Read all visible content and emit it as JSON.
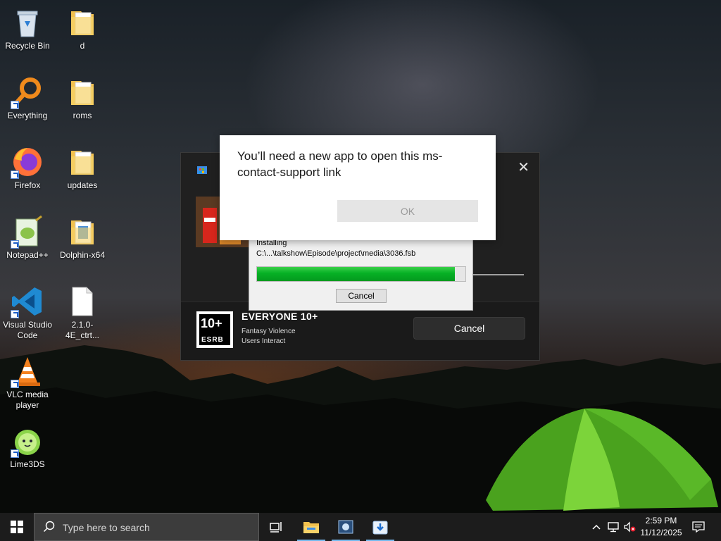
{
  "desktop": {
    "icons": [
      {
        "label": "Recycle Bin"
      },
      {
        "label": "d"
      },
      {
        "label": "Everything"
      },
      {
        "label": "roms"
      },
      {
        "label": "Firefox"
      },
      {
        "label": "updates"
      },
      {
        "label": "Notepad++"
      },
      {
        "label": "Dolphin-x64"
      },
      {
        "label": "Visual Studio Code"
      },
      {
        "label": "2.1.0-4E_ctrt..."
      },
      {
        "label": "VLC media player"
      },
      {
        "label": "Lime3DS"
      }
    ]
  },
  "prompt": {
    "message": "You’ll need a new app to open this ms-contact-support link",
    "ok_label": "OK"
  },
  "store_window": {
    "close_icon": "close-icon",
    "rating": "EVERYONE 10+",
    "rating_descriptor_1": "Fantasy Violence",
    "rating_descriptor_2": "Users Interact",
    "esrb_big": "10+",
    "esrb_small": "ESRB",
    "cancel_label": "Cancel"
  },
  "installer": {
    "status": "Installing",
    "path": "C:\\...\\talkshow\\Episode\\project\\media\\3036.fsb",
    "progress": 0.95,
    "cancel_label": "Cancel"
  },
  "taskbar": {
    "search_placeholder": "Type here to search",
    "time": "2:59 PM",
    "date": "11/12/2025"
  },
  "colors": {
    "progress_green": "#06b025",
    "taskbar_bg": "#1c1c1c",
    "accent_blue": "#76b9ed"
  }
}
